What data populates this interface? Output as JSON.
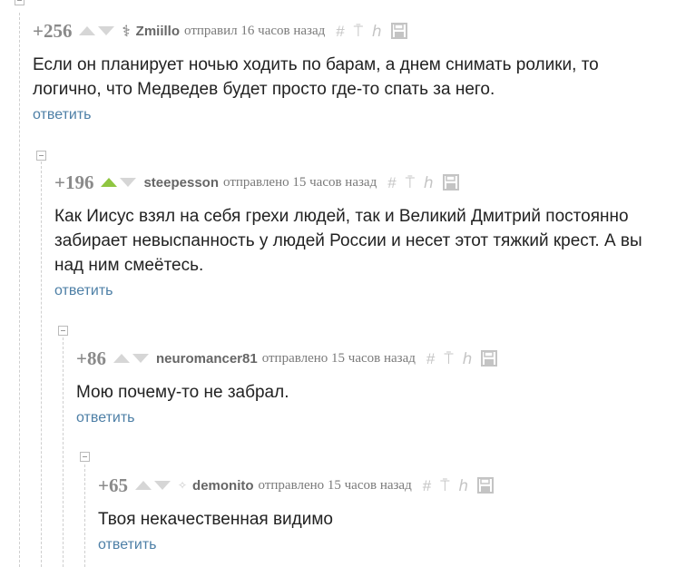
{
  "comments": [
    {
      "rating": "+256",
      "vote_state": "neutral",
      "user_icon": "medical-symbol-icon",
      "user_icon_glyph": "⚕",
      "username": "Zmiillo",
      "posted": "отправил 16 часов назад",
      "text": "Если он планирует ночью ходить по барам, а днем снимать ролики, то логично, что Медведев будет просто где-то спать за него.",
      "reply_label": "ответить"
    },
    {
      "rating": "+196",
      "vote_state": "upvoted",
      "username": "steepesson",
      "posted": "отправлено 15 часов назад",
      "text": "Как Иисус взял на себя грехи людей, так и Великий Дмитрий постоянно забирает невыспанность у людей России и несет этот тяжкий крест. А вы над ним смеётесь.",
      "reply_label": "ответить"
    },
    {
      "rating": "+86",
      "vote_state": "neutral",
      "username": "neuromancer81",
      "posted": "отправлено 15 часов назад",
      "text": "Мою почему-то не забрал.",
      "reply_label": "ответить"
    },
    {
      "rating": "+65",
      "vote_state": "neutral",
      "user_icon": "small-award-icon",
      "user_icon_glyph": "✧",
      "username": "demonito",
      "posted": "отправлено 15 часов назад",
      "text": "Твоя некачественная видимо",
      "reply_label": "ответить"
    }
  ],
  "toolbar_icons": [
    "hash-icon",
    "pin-icon",
    "branch-icon",
    "save-icon"
  ],
  "toolbar_glyphs": {
    "hash": "#",
    "pin": "⍑",
    "branch": "ℎ"
  },
  "colors": {
    "upvote_active": "#8fc641",
    "vote_inactive": "#d6d6d6",
    "link": "#4d7fa6",
    "meta": "#7a7a7a"
  }
}
